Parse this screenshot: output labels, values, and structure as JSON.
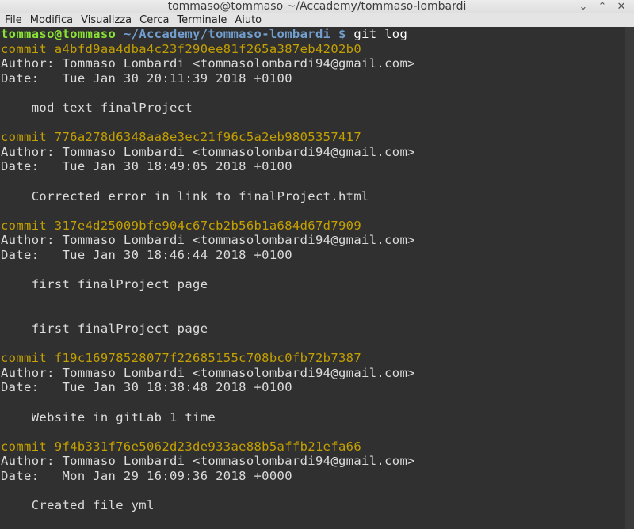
{
  "window": {
    "title": "tommaso@tommaso ~/Accademy/tommaso-lombardi",
    "controls": {
      "minimize": "⌄",
      "maximize": "⌃",
      "close": "✕"
    }
  },
  "menu": [
    "File",
    "Modifica",
    "Visualizza",
    "Cerca",
    "Terminale",
    "Aiuto"
  ],
  "prompt": {
    "user_host": "tommaso@tommaso",
    "path": " ~/Accademy/tommaso-lombardi $",
    "command": " git log"
  },
  "log_lines": [
    {
      "kind": "commit",
      "text": "commit a4bfd9aa4dba4c23f290ee81f265a387eb4202b0"
    },
    {
      "kind": "text",
      "text": "Author: Tommaso Lombardi <tommasolombardi94@gmail.com>"
    },
    {
      "kind": "text",
      "text": "Date:   Tue Jan 30 20:11:39 2018 +0100"
    },
    {
      "kind": "text",
      "text": ""
    },
    {
      "kind": "text",
      "text": "    mod text finalProject"
    },
    {
      "kind": "text",
      "text": ""
    },
    {
      "kind": "commit",
      "text": "commit 776a278d6348aa8e3ec21f96c5a2eb9805357417"
    },
    {
      "kind": "text",
      "text": "Author: Tommaso Lombardi <tommasolombardi94@gmail.com>"
    },
    {
      "kind": "text",
      "text": "Date:   Tue Jan 30 18:49:05 2018 +0100"
    },
    {
      "kind": "text",
      "text": ""
    },
    {
      "kind": "text",
      "text": "    Corrected error in link to finalProject.html"
    },
    {
      "kind": "text",
      "text": ""
    },
    {
      "kind": "commit",
      "text": "commit 317e4d25009bfe904c67cb2b56b1a684d67d7909"
    },
    {
      "kind": "text",
      "text": "Author: Tommaso Lombardi <tommasolombardi94@gmail.com>"
    },
    {
      "kind": "text",
      "text": "Date:   Tue Jan 30 18:46:44 2018 +0100"
    },
    {
      "kind": "text",
      "text": ""
    },
    {
      "kind": "text",
      "text": "    first finalProject page"
    },
    {
      "kind": "text",
      "text": ""
    },
    {
      "kind": "text",
      "text": ""
    },
    {
      "kind": "text",
      "text": "    first finalProject page"
    },
    {
      "kind": "text",
      "text": ""
    },
    {
      "kind": "commit",
      "text": "commit f19c16978528077f22685155c708bc0fb72b7387"
    },
    {
      "kind": "text",
      "text": "Author: Tommaso Lombardi <tommasolombardi94@gmail.com>"
    },
    {
      "kind": "text",
      "text": "Date:   Tue Jan 30 18:38:48 2018 +0100"
    },
    {
      "kind": "text",
      "text": ""
    },
    {
      "kind": "text",
      "text": "    Website in gitLab 1 time"
    },
    {
      "kind": "text",
      "text": ""
    },
    {
      "kind": "commit",
      "text": "commit 9f4b331f76e5062d23de933ae88b5affb21efa66"
    },
    {
      "kind": "text",
      "text": "Author: Tommaso Lombardi <tommasolombardi94@gmail.com>"
    },
    {
      "kind": "text",
      "text": "Date:   Mon Jan 29 16:09:36 2018 +0000"
    },
    {
      "kind": "text",
      "text": ""
    },
    {
      "kind": "text",
      "text": "    Created file yml"
    }
  ],
  "colors": {
    "terminal_bg": "#303030",
    "text": "#dcdcdc",
    "commit_hash": "#c4a000",
    "prompt_user": "#8ae234",
    "prompt_path": "#729fcf"
  }
}
